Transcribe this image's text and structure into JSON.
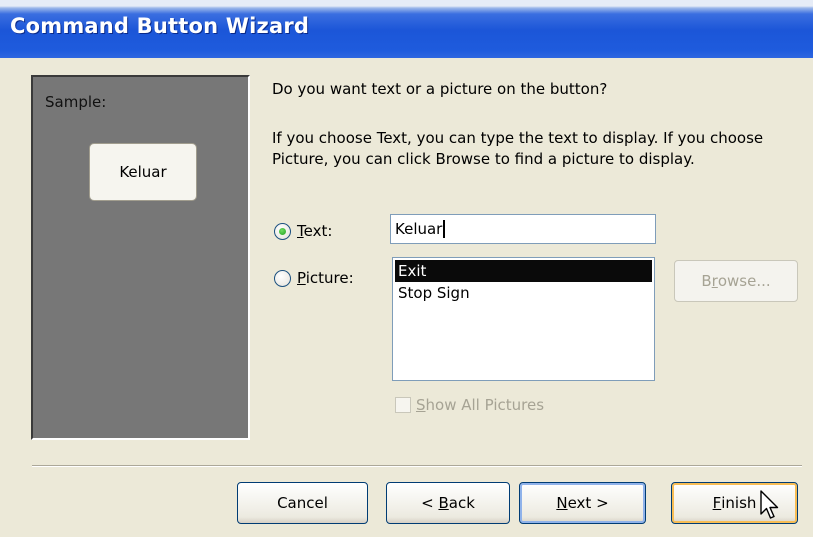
{
  "window": {
    "title": "Command Button Wizard"
  },
  "sample": {
    "label": "Sample:",
    "button_text": "Keluar"
  },
  "prompt": "Do you want text or a picture on the button?",
  "explanation": "If you choose Text, you can type the text to display.  If you choose Picture, you can click Browse to find a picture to display.",
  "options": {
    "text": {
      "label_underlined": "T",
      "label_rest": "ext:",
      "checked": true,
      "value": "Keluar"
    },
    "picture": {
      "label_underlined": "P",
      "label_rest": "icture:",
      "checked": false
    }
  },
  "picture_list": {
    "items": [
      "Exit",
      "Stop Sign"
    ],
    "selected": "Exit"
  },
  "browse_button": {
    "before": "B",
    "underlined": "r",
    "after": "owse..."
  },
  "show_all_pictures": {
    "before": "",
    "underlined": "S",
    "after": "how All Pictures",
    "checked": false
  },
  "footer": {
    "cancel": "Cancel",
    "back": {
      "before": "< ",
      "underlined": "B",
      "after": "ack"
    },
    "next": {
      "before": "",
      "underlined": "N",
      "after": "ext >"
    },
    "finish": {
      "before": "",
      "underlined": "F",
      "after": "inish"
    }
  },
  "colors": {
    "titlebar": "#1c56d8",
    "dialog_bg": "#ece9d8",
    "sample_bg": "#777777",
    "selection": "#0a0a0a",
    "radio_checked": "#21a121"
  }
}
